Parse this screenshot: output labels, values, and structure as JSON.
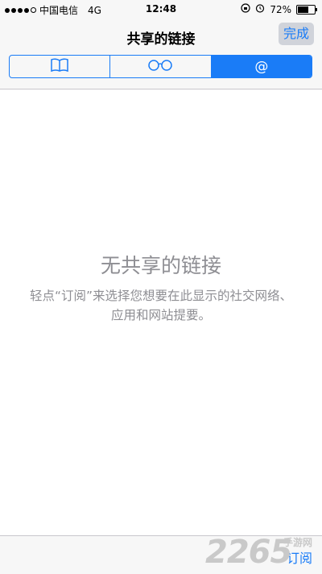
{
  "status_bar": {
    "carrier": "中国电信",
    "network": "4G",
    "time": "12:48",
    "battery_percent": "72%",
    "battery_level": 0.72
  },
  "nav": {
    "title": "共享的链接",
    "done_label": "完成"
  },
  "segments": [
    {
      "icon": "book-icon",
      "active": false
    },
    {
      "icon": "glasses-icon",
      "active": false
    },
    {
      "icon": "at-icon",
      "label": "@",
      "active": true
    }
  ],
  "empty_state": {
    "title": "无共享的链接",
    "description": "轻点“订阅”来选择您想要在此显示的社交网络、应用和网站提要。"
  },
  "toolbar": {
    "subscribe_label": "订阅"
  },
  "watermark": {
    "text": "2265",
    "sub": "手游网"
  },
  "colors": {
    "accent": "#1a7cf7",
    "muted_text": "#8e8e93",
    "bar_bg": "#f7f7f7"
  }
}
